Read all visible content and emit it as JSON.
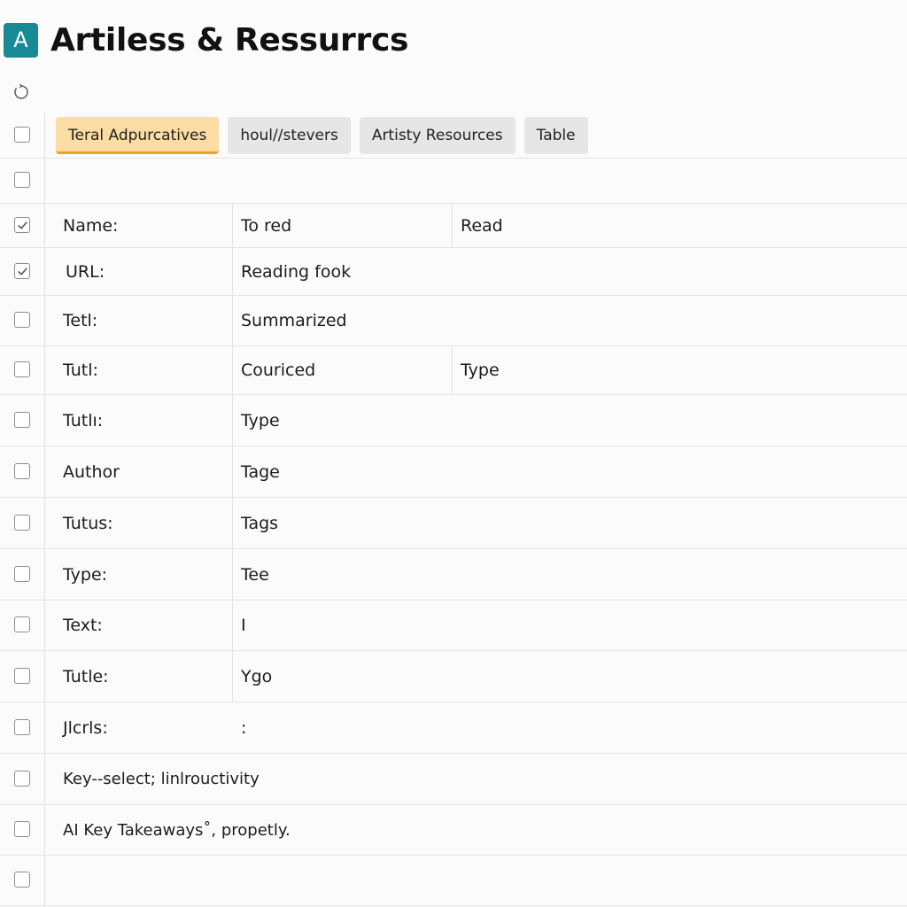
{
  "app": {
    "logo_letter": "A",
    "title": "Artiless & Ressurrcs"
  },
  "toolbar": {
    "refresh_icon": "refresh-icon"
  },
  "tabs": [
    {
      "label": "Teral Adpurcatives",
      "active": true
    },
    {
      "label": "houl//stevers",
      "active": false
    },
    {
      "label": "Artisty Resources",
      "active": false
    },
    {
      "label": "Table",
      "active": false
    }
  ],
  "rows": [
    {
      "checked": true,
      "c1": "Name:",
      "c2": "To red",
      "c3": "Read"
    },
    {
      "checked": true,
      "c1": "URL:",
      "c2": "Reading fook"
    },
    {
      "checked": false,
      "c1": "Tetl:",
      "c2": "Summarized"
    },
    {
      "checked": false,
      "c1": "Tutl:",
      "c2": "Couriced",
      "c3": "Type"
    },
    {
      "checked": false,
      "c1": "Tutlı:",
      "c2": "Type"
    },
    {
      "checked": false,
      "c1": "Author",
      "c2": "Tage"
    },
    {
      "checked": false,
      "c1": "Tutus:",
      "c2": "Tags"
    },
    {
      "checked": false,
      "c1": "Type:",
      "c2": "Tee"
    },
    {
      "checked": false,
      "c1": "Text:",
      "c2": "I"
    },
    {
      "checked": false,
      "c1": "Tutle:",
      "c2": "Ygo"
    },
    {
      "checked": false,
      "c1": "Jlcrls:",
      "c2": ":"
    }
  ],
  "notes": [
    "Key--select; linlrouctivity",
    "AI Key Takeaways˚, propetly."
  ],
  "colors": {
    "accent": "#178a96",
    "active_tab": "#fbdca2",
    "active_tab_underline": "#f0a030"
  }
}
